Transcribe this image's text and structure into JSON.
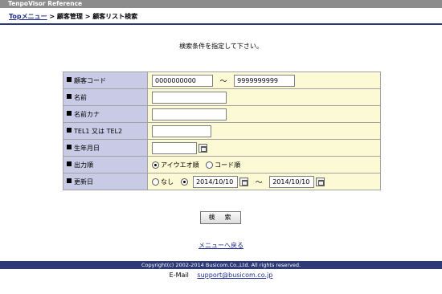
{
  "header": {
    "title": "TenpoVisor Reference"
  },
  "breadcrumb": {
    "home": "Topメニュー",
    "sep1": " > ",
    "section": "顧客管理",
    "sep2": " > ",
    "current": "顧客リスト検索"
  },
  "instruction": "検索条件を指定して下さい。",
  "form": {
    "customer_code": {
      "label": "顧客コード",
      "from": "0000000000",
      "tilde": "～",
      "to": "9999999999"
    },
    "name": {
      "label": "名前",
      "value": ""
    },
    "name_kana": {
      "label": "名前カナ",
      "value": ""
    },
    "tel": {
      "label": "TEL1 又は TEL2",
      "value": ""
    },
    "birthdate": {
      "label": "生年月日",
      "value": ""
    },
    "order": {
      "label": "出力順",
      "options": [
        "アイウエオ順",
        "コード順"
      ],
      "selected": "アイウエオ順"
    },
    "updated": {
      "label": "更新日",
      "none_label": "なし",
      "from": "2014/10/10",
      "tilde": "～",
      "to": "2014/10/10"
    }
  },
  "search_button": "検　索",
  "back_link": "メニューへ戻る",
  "footer": {
    "copyright": "Copyright(c) 2002-2014 Busicom.Co.,Ltd. All rights reserved.",
    "email_label": "E-Mail",
    "email": "support@busicom.co.jp"
  },
  "colors": {
    "label_bg": "#c9cbe6",
    "value_bg": "#fcfad4",
    "footer_bg": "#2d3a78",
    "topbar_bg": "#8c8c8c"
  }
}
